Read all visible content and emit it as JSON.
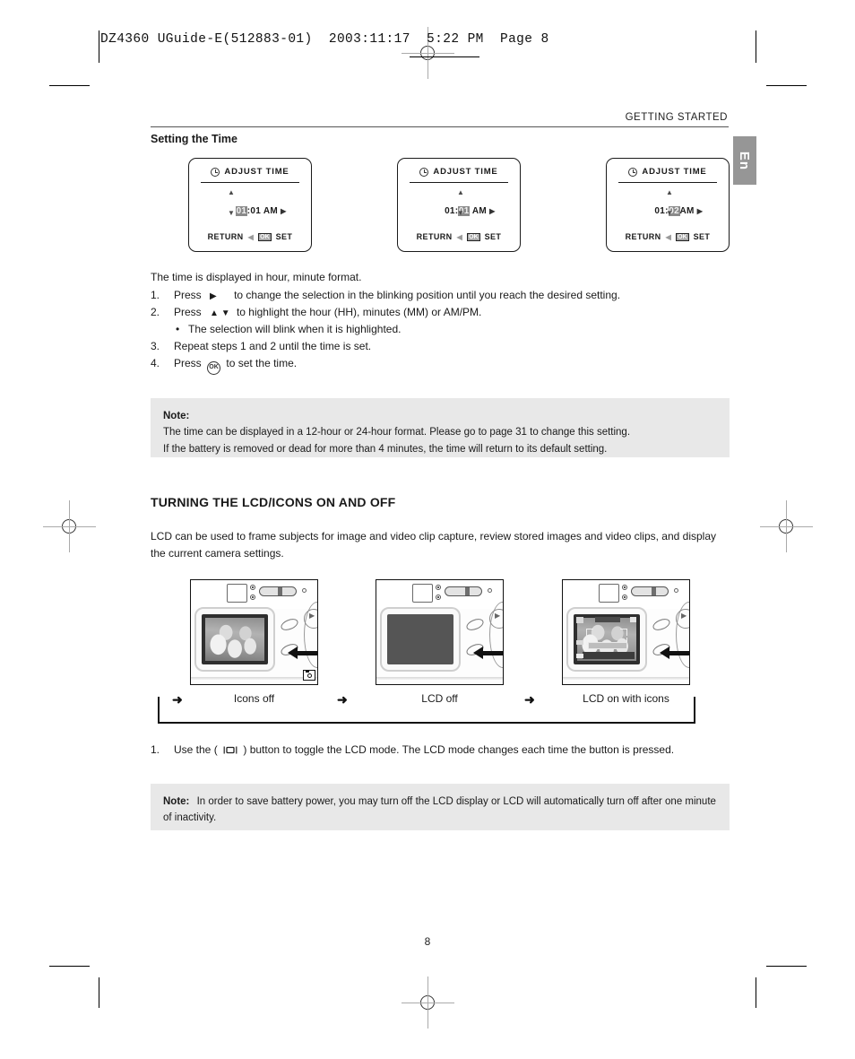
{
  "film_header": {
    "text": "DZ4360 UGuide-E(512883-01)  2003:11:17  5:22 PM  Page 8"
  },
  "running_head": "GETTING STARTED",
  "language_tab": "En",
  "section_sub_heading": "Setting the Time",
  "lcd_screens": [
    {
      "title": "ADJUST TIME",
      "clock_icon": "clock-icon",
      "time_prefix": "",
      "highlight": "01",
      "time_suffix": ":01 AM",
      "right_arrow": "▶",
      "up_arrow": "▲",
      "down_arrow": "▼",
      "return_label": "RETURN",
      "left_arrow": "◀",
      "ok_label": "OK",
      "set_label": "SET"
    },
    {
      "title": "ADJUST TIME",
      "clock_icon": "clock-icon",
      "time_prefix": "01:",
      "highlight": "01",
      "time_suffix": " AM",
      "right_arrow": "▶",
      "up_arrow": "▲",
      "down_arrow": "▼",
      "return_label": "RETURN",
      "left_arrow": "◀",
      "ok_label": "OK",
      "set_label": "SET"
    },
    {
      "title": "ADJUST TIME",
      "clock_icon": "clock-icon",
      "time_prefix": "01:",
      "highlight": "02",
      "time_suffix": "AM",
      "right_arrow": "▶",
      "up_arrow": "▲",
      "down_arrow": "▼",
      "return_label": "RETURN",
      "left_arrow": "◀",
      "ok_label": "OK",
      "set_label": "SET"
    }
  ],
  "intro_line": "The time is displayed in hour, minute format.",
  "steps": [
    {
      "num": "1.",
      "lead": "Press",
      "glyph": "▶",
      "text": "to change the selection in the blinking position until you reach the desired setting."
    },
    {
      "num": "2.",
      "lead": "Press",
      "glyph": "▲ ▼",
      "text": "to highlight the hour (HH), minutes (MM) or AM/PM."
    },
    {
      "bullet": "•",
      "text": "The selection will blink when it is highlighted."
    },
    {
      "num": "3.",
      "text": "Repeat steps 1 and 2 until the time is set."
    },
    {
      "num": "4.",
      "lead": "Press",
      "glyph_icon": "ok-button-icon",
      "glyph_label": "OK",
      "text": "to set the time."
    }
  ],
  "note_1": {
    "label": "Note:",
    "lines": [
      "The time can be displayed in a 12-hour or 24-hour format. Please go to page 31 to change this setting.",
      "If the battery is removed or dead for more than 4 minutes, the time will return to its default setting."
    ]
  },
  "section_title": "TURNING THE LCD/ICONS ON AND OFF",
  "section_body": "LCD can be used to frame subjects for image and video clip capture, review stored images and video clips, and display the current camera settings.",
  "camera_figures": [
    {
      "caption": "Icons off",
      "state": "icons-off"
    },
    {
      "caption": "LCD off",
      "state": "lcd-off"
    },
    {
      "caption": "LCD on with icons",
      "state": "lcd-on-icons"
    }
  ],
  "flow_arrow": "➜",
  "toggle_step": {
    "num": "1.",
    "pre": "Use the (",
    "icon": "lcd-toggle-icon",
    "post": ") button to toggle the LCD mode. The LCD mode changes each time the button is pressed."
  },
  "note_2": {
    "label": "Note:",
    "text": "In order to save battery power, you may turn off the LCD display or LCD will automatically turn off after one minute of inactivity."
  },
  "page_number": "8"
}
